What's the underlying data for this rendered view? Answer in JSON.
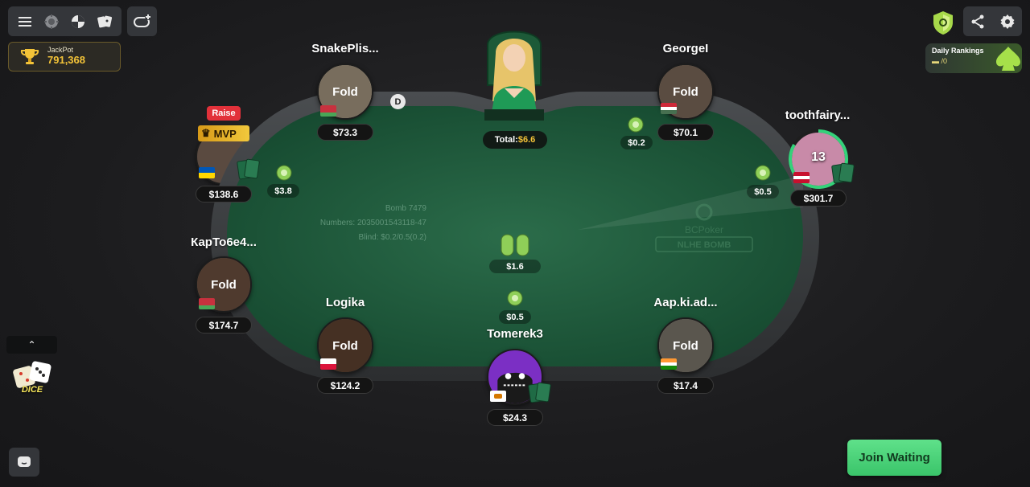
{
  "jackpot": {
    "label": "JackPot",
    "value": "791,368"
  },
  "rankings": {
    "title": "Daily Rankings",
    "value": "/0"
  },
  "sidebar": {
    "dice_label": "DICE"
  },
  "table": {
    "bomb_id": "Bomb 7479",
    "numbers": "Numbers: 2035001543118-47",
    "blind": "Blind: $0.2/0.5(0.2)",
    "brand": "BCPoker",
    "game_type": "NLHE BOMB",
    "total_label": "Total:",
    "total_value": "$6.6",
    "main_pot": "$1.6",
    "dealer_button": "D"
  },
  "players": [
    {
      "name": "SnakePlis...",
      "stack": "$73.3",
      "status": "Fold"
    },
    {
      "name": "GeorgeI",
      "stack": "$70.1",
      "status": "Fold",
      "bet": "$0.2"
    },
    {
      "name": "toothfairy...",
      "stack": "$301.7",
      "timer": "13",
      "bet": "$0.5"
    },
    {
      "name": "",
      "stack": "$138.6",
      "action": "Raise",
      "badge": "MVP",
      "bet": "$3.8"
    },
    {
      "name": "КарТо6е4...",
      "stack": "$174.7",
      "status": "Fold"
    },
    {
      "name": "Logika",
      "stack": "$124.2",
      "status": "Fold"
    },
    {
      "name": "Tomerek3",
      "stack": "$24.3",
      "bet": "$0.5"
    },
    {
      "name": "Aap.ki.ad...",
      "stack": "$17.4",
      "status": "Fold"
    }
  ],
  "actions": {
    "join_waiting": "Join Waiting"
  },
  "colors": {
    "felt": "#1f5a3c",
    "rail": "#3b3d3f",
    "accent": "#3ac46a",
    "gold": "#f3c338",
    "raise": "#e2313a"
  }
}
